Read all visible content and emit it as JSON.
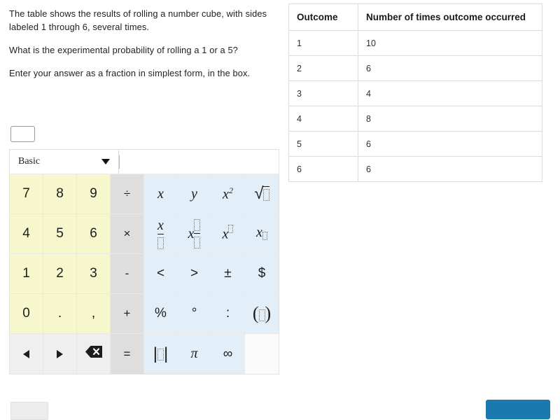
{
  "question": {
    "paragraphs": [
      "The table shows the results of rolling a number cube, with sides labeled 1 through 6, several times.",
      "What is the experimental probability of rolling a 1 or a 5?",
      "Enter your answer as a fraction in simplest form, in the box."
    ]
  },
  "answer_input": {
    "value": "",
    "placeholder": ""
  },
  "keypad": {
    "mode_label": "Basic",
    "mode_icon": "chevron-down-icon",
    "expression_value": "",
    "rows": [
      [
        {
          "label": "7",
          "kind": "num",
          "name": "key-7"
        },
        {
          "label": "8",
          "kind": "num",
          "name": "key-8"
        },
        {
          "label": "9",
          "kind": "num",
          "name": "key-9"
        },
        {
          "label": "÷",
          "kind": "op",
          "name": "key-divide"
        },
        {
          "label": "x",
          "kind": "sym",
          "name": "key-variable-x"
        },
        {
          "label": "y",
          "kind": "sym",
          "name": "key-variable-y"
        },
        {
          "label": "x²",
          "kind": "sym",
          "name": "key-x-squared"
        },
        {
          "label": "√□",
          "kind": "sym",
          "name": "key-square-root"
        }
      ],
      [
        {
          "label": "4",
          "kind": "num",
          "name": "key-4"
        },
        {
          "label": "5",
          "kind": "num",
          "name": "key-5"
        },
        {
          "label": "6",
          "kind": "num",
          "name": "key-6"
        },
        {
          "label": "×",
          "kind": "op",
          "name": "key-multiply"
        },
        {
          "label": "x/□",
          "kind": "sym",
          "name": "key-fraction"
        },
        {
          "label": "x □/□",
          "kind": "sym",
          "name": "key-mixed-number"
        },
        {
          "label": "x^□",
          "kind": "sym",
          "name": "key-exponent"
        },
        {
          "label": "x_□",
          "kind": "sym",
          "name": "key-subscript"
        }
      ],
      [
        {
          "label": "1",
          "kind": "num",
          "name": "key-1"
        },
        {
          "label": "2",
          "kind": "num",
          "name": "key-2"
        },
        {
          "label": "3",
          "kind": "num",
          "name": "key-3"
        },
        {
          "label": "-",
          "kind": "op",
          "name": "key-minus"
        },
        {
          "label": "<",
          "kind": "sym",
          "name": "key-less-than"
        },
        {
          "label": ">",
          "kind": "sym",
          "name": "key-greater-than"
        },
        {
          "label": "±",
          "kind": "sym",
          "name": "key-plus-minus"
        },
        {
          "label": "$",
          "kind": "sym",
          "name": "key-dollar-sign"
        }
      ],
      [
        {
          "label": "0",
          "kind": "num",
          "name": "key-0"
        },
        {
          "label": ".",
          "kind": "num",
          "name": "key-decimal-point"
        },
        {
          "label": ",",
          "kind": "num",
          "name": "key-comma"
        },
        {
          "label": "+",
          "kind": "op",
          "name": "key-plus"
        },
        {
          "label": "%",
          "kind": "sym",
          "name": "key-percent"
        },
        {
          "label": "°",
          "kind": "sym",
          "name": "key-degree"
        },
        {
          "label": ":",
          "kind": "sym",
          "name": "key-colon"
        },
        {
          "label": "(□)",
          "kind": "sym",
          "name": "key-parentheses"
        }
      ],
      [
        {
          "label": "◄",
          "kind": "nav",
          "name": "key-cursor-left"
        },
        {
          "label": "►",
          "kind": "nav",
          "name": "key-cursor-right"
        },
        {
          "label": "⌫",
          "kind": "nav",
          "name": "key-backspace"
        },
        {
          "label": "=",
          "kind": "op",
          "name": "key-equals"
        },
        {
          "label": "|□|",
          "kind": "sym",
          "name": "key-absolute-value"
        },
        {
          "label": "π",
          "kind": "sym",
          "name": "key-pi"
        },
        {
          "label": "∞",
          "kind": "sym",
          "name": "key-infinity"
        },
        {
          "label": "",
          "kind": "blank",
          "name": "key-blank"
        }
      ]
    ]
  },
  "table": {
    "columns": [
      "Outcome",
      "Number of times outcome occurred"
    ],
    "rows": [
      [
        "1",
        "10"
      ],
      [
        "2",
        "6"
      ],
      [
        "3",
        "4"
      ],
      [
        "4",
        "8"
      ],
      [
        "5",
        "6"
      ],
      [
        "6",
        "6"
      ]
    ]
  },
  "actions": {
    "secondary_label": "",
    "primary_label": ""
  },
  "colors": {
    "keypad_number": "#f7f7ce",
    "keypad_operator": "#dedede",
    "keypad_symbol": "#e2eff9",
    "keypad_nav": "#efefef",
    "primary_button": "#1a7aaf",
    "secondary_button": "#ececec"
  }
}
